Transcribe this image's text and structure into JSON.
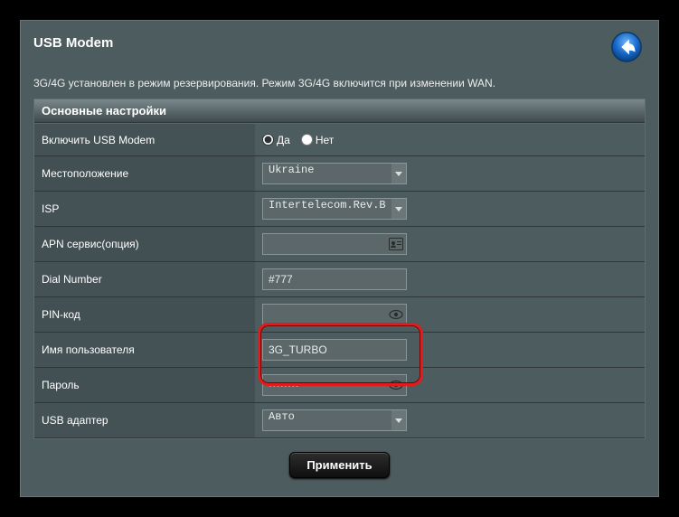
{
  "header": {
    "title": "USB Modem"
  },
  "note": "3G/4G установлен в режим резервирования. Режим 3G/4G включится при изменении WAN.",
  "panel": {
    "title": "Основные настройки"
  },
  "rows": {
    "enable": {
      "label": "Включить USB Modem",
      "yes": "Да",
      "no": "Нет",
      "value": "yes"
    },
    "location": {
      "label": "Местоположение",
      "value": "Ukraine"
    },
    "isp": {
      "label": "ISP",
      "value": "Intertelecom.Rev.B"
    },
    "apn": {
      "label": "APN сервис(опция)",
      "value": ""
    },
    "dial": {
      "label": "Dial Number",
      "value": "#777"
    },
    "pin": {
      "label": "PIN-код",
      "value": ""
    },
    "user": {
      "label": "Имя пользователя",
      "value": "3G_TURBO"
    },
    "pass": {
      "label": "Пароль",
      "value": "••••••••"
    },
    "adapter": {
      "label": "USB адаптер",
      "value": "Авто"
    }
  },
  "apply": "Применить"
}
